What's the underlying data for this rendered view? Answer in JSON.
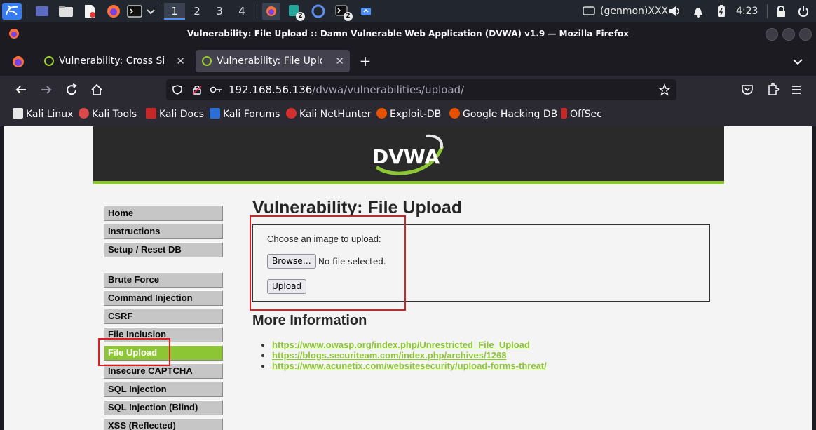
{
  "panel": {
    "workspaces": [
      "1",
      "2",
      "3",
      "4"
    ],
    "genmon": "(genmon)XXX",
    "clock": "4:23",
    "badges": [
      "2",
      "2"
    ]
  },
  "window": {
    "title": "Vulnerability: File Upload :: Damn Vulnerable Web Application (DVWA) v1.9 — Mozilla Firefox"
  },
  "tabs": [
    {
      "label": "Vulnerability: Cross Site R",
      "close": "✕"
    },
    {
      "label": "Vulnerability: File Upload",
      "close": "✕"
    }
  ],
  "newtab": "+",
  "url": {
    "host": "192.168.56.136",
    "path": "/dvwa/vulnerabilities/upload/"
  },
  "bookmarks": [
    {
      "label": "Kali Linux",
      "color": "#e8e8e8"
    },
    {
      "label": "Kali Tools",
      "color": "#d94a4a"
    },
    {
      "label": "Kali Docs",
      "color": "#c62828"
    },
    {
      "label": "Kali Forums",
      "color": "#2b6fd6"
    },
    {
      "label": "Kali NetHunter",
      "color": "#d32f2f"
    },
    {
      "label": "Exploit-DB",
      "color": "#e65100"
    },
    {
      "label": "Google Hacking DB",
      "color": "#e65100"
    },
    {
      "label": "OffSec",
      "color": "#c62828"
    }
  ],
  "dvwa": {
    "logo": "DVWA",
    "menu": [
      "Home",
      "Instructions",
      "Setup / Reset DB",
      "Brute Force",
      "Command Injection",
      "CSRF",
      "File Inclusion",
      "File Upload",
      "Insecure CAPTCHA",
      "SQL Injection",
      "SQL Injection (Blind)",
      "XSS (Reflected)"
    ],
    "active_menu": "File Upload",
    "heading": "Vulnerability: File Upload",
    "upload_label": "Choose an image to upload:",
    "browse_label": "Browse…",
    "no_file": "No file selected.",
    "upload_button": "Upload",
    "more_info": "More Information",
    "links": [
      "https://www.owasp.org/index.php/Unrestricted_File_Upload",
      "https://blogs.securiteam.com/index.php/archives/1268",
      "https://www.acunetix.com/websitesecurity/upload-forms-threat/"
    ],
    "accent": "#8cc634"
  }
}
